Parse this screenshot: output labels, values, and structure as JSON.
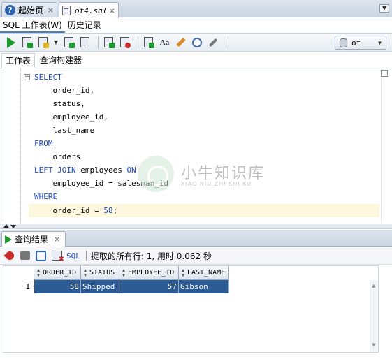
{
  "doc_tabs": [
    {
      "label": "起始页",
      "close": "×"
    },
    {
      "label": "ot4.sql",
      "close": "×"
    }
  ],
  "sub_tabs": {
    "worksheet": "SQL 工作表(W)",
    "history": "历史记录"
  },
  "toolbar": {
    "icons": [
      "run-statement-icon",
      "run-script-icon",
      "autotrace-icon",
      "explain-plan-icon",
      "sql-tuning-icon",
      "commit-icon",
      "rollback-icon",
      "unshared-sql-icon",
      "to-upper-lower-icon",
      "clear-icon",
      "history-icon",
      "sql-tuning-advisor-icon"
    ],
    "connection": "ot"
  },
  "editor_tabs": {
    "worksheet": "工作表",
    "query_builder": "查询构建器"
  },
  "code": [
    {
      "kw": "SELECT",
      "rest": ""
    },
    {
      "kw": "",
      "rest": "    order_id,"
    },
    {
      "kw": "",
      "rest": "    status,"
    },
    {
      "kw": "",
      "rest": "    employee_id,"
    },
    {
      "kw": "",
      "rest": "    last_name"
    },
    {
      "kw": "FROM",
      "rest": ""
    },
    {
      "kw": "",
      "rest": "    orders"
    },
    {
      "kw": "LEFT JOIN",
      "mid": " employees ",
      "kw2": "ON"
    },
    {
      "kw": "",
      "rest": "    employee_id = salesman_id"
    },
    {
      "kw": "WHERE",
      "rest": ""
    },
    {
      "kw": "",
      "pre": "    order_id = ",
      "num": "58",
      "post": ";"
    }
  ],
  "watermark": {
    "text": "小牛知识库",
    "sub": "XIAO NIU ZHI SHI KU"
  },
  "results": {
    "tab_label": "查询结果",
    "close": "×",
    "sql_label": "SQL",
    "status": "提取的所有行: 1, 用时 0.062 秒",
    "columns": [
      "ORDER_ID",
      "STATUS",
      "EMPLOYEE_ID",
      "LAST_NAME"
    ],
    "rows": [
      {
        "num": "1",
        "cells": [
          "58",
          "Shipped",
          "57",
          "Gibson"
        ]
      }
    ]
  },
  "colors": {
    "keyword": "#1f4bc4",
    "selection": "#2c5a92",
    "current_line": "#fdf7dd",
    "run_green": "#1a9a2a"
  }
}
